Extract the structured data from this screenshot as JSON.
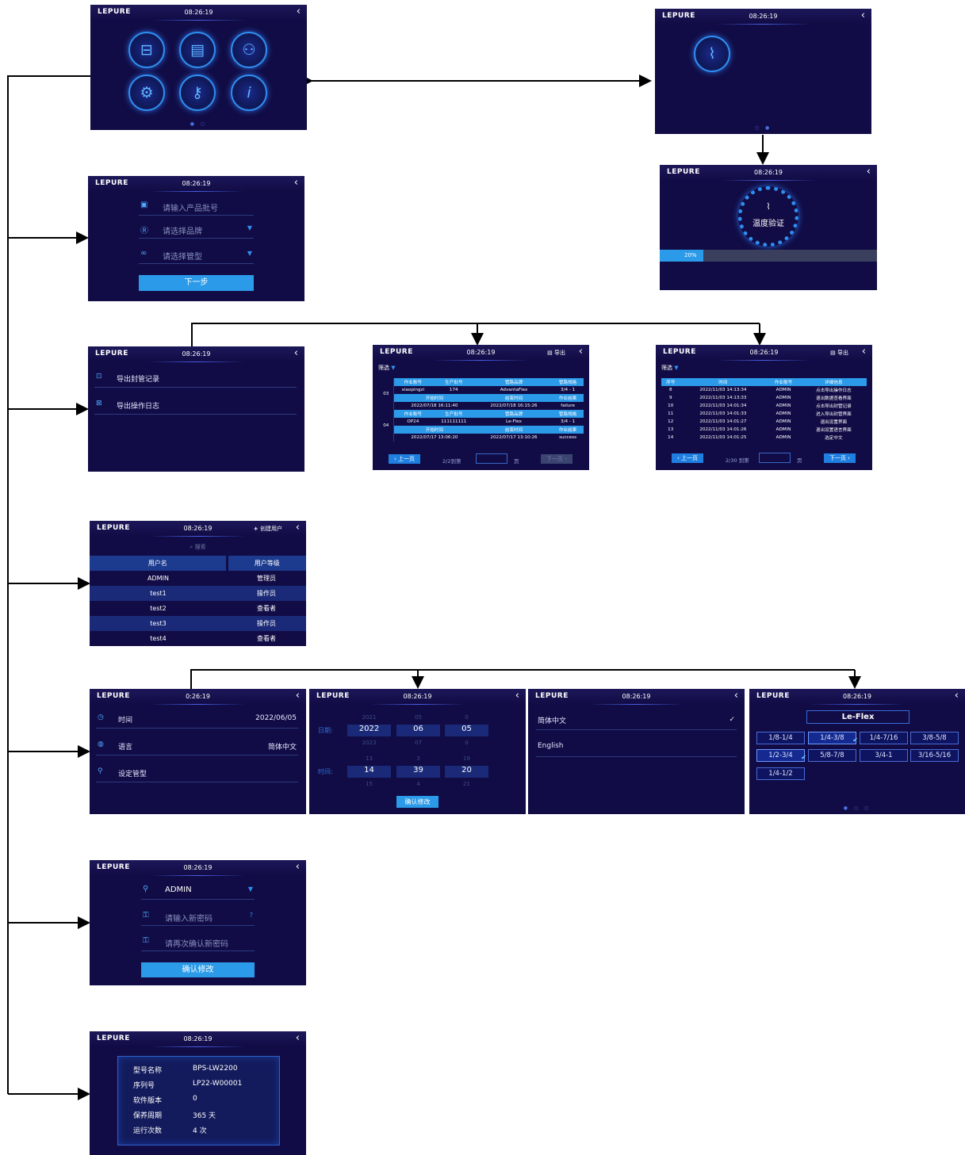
{
  "header": {
    "logo": "LEPURE",
    "time": "08:26:19",
    "time_alt": "0:26:19",
    "back": "‹"
  },
  "home": {
    "pager": "● ○",
    "pager2": "○ ●"
  },
  "temp": {
    "title": "温度验证",
    "progress_label": "20%",
    "progress_value": 0.2
  },
  "batch": {
    "product_placeholder": "请输入产品批号",
    "brand_placeholder": "请选择品牌",
    "tube_placeholder": "请选择管型",
    "next_label": "下一步"
  },
  "export": {
    "item1": "导出封管记录",
    "item2": "导出操作日志",
    "export_label": "导出",
    "filter_label": "筛选"
  },
  "record_table": {
    "head1": [
      "作业账号",
      "生产批号",
      "管路品牌",
      "管路规格"
    ],
    "head2": [
      "开始时间",
      "结束时间",
      "作业结果"
    ],
    "rows": [
      {
        "id": "03",
        "acct": "xiaopingzi",
        "lot": "174",
        "brand": "AdvantaFlex",
        "spec": "3/4 - 1",
        "start": "2022/07/18 16:11:40",
        "end": "2022/07/18 16:15:26",
        "result": "failure"
      },
      {
        "id": "04",
        "acct": "OP24",
        "lot": "111111111",
        "brand": "Le-Flex",
        "spec": "3/4 - 1",
        "start": "2022/07/17 13:06:20",
        "end": "2022/07/17 13:10:26",
        "result": "success"
      }
    ],
    "prev": "上一页",
    "next": "下一页",
    "page_info": "2/2到第",
    "page_unit": "页"
  },
  "log_table": {
    "head": [
      "序号",
      "时间",
      "作业账号",
      "详细信息"
    ],
    "rows": [
      [
        "8",
        "2022/11/03 14:13:34",
        "ADMIN",
        "点击导出操作日志"
      ],
      [
        "9",
        "2022/11/03 14:13:33",
        "ADMIN",
        "退出数据查看界面"
      ],
      [
        "10",
        "2022/11/03 14:01:34",
        "ADMIN",
        "点击导出封管记录"
      ],
      [
        "11",
        "2022/11/03 14:01:33",
        "ADMIN",
        "进入导出封管界面"
      ],
      [
        "12",
        "2022/11/03 14:01:27",
        "ADMIN",
        "退出设置界面"
      ],
      [
        "13",
        "2022/11/03 14:01:26",
        "ADMIN",
        "退出设置语言界面"
      ],
      [
        "14",
        "2022/11/03 14:01:25",
        "ADMIN",
        "选定中文"
      ]
    ],
    "prev": "上一页",
    "next": "下一页",
    "page_info": "2/30 到第",
    "page_unit": "页"
  },
  "users": {
    "create": "创建用户",
    "search": "搜索",
    "col_name": "用户名",
    "col_level": "用户等级",
    "rows": [
      [
        "ADMIN",
        "管理员"
      ],
      [
        "test1",
        "操作员"
      ],
      [
        "test2",
        "查看者"
      ],
      [
        "test3",
        "操作员"
      ],
      [
        "test4",
        "查看者"
      ]
    ]
  },
  "settings": {
    "time_label": "时间",
    "time_value": "2022/06/05",
    "lang_label": "语言",
    "lang_value": "简体中文",
    "tube_label": "设定管型"
  },
  "datetime": {
    "date_label": "日期:",
    "time_label": "时间:",
    "date_above": [
      "2021",
      "05",
      "0"
    ],
    "date_sel": [
      "2022",
      "06",
      "05"
    ],
    "date_below": [
      "2023",
      "07",
      "0"
    ],
    "time_above": [
      "13",
      "3",
      "19"
    ],
    "time_sel": [
      "14",
      "39",
      "20"
    ],
    "time_below": [
      "15",
      "4",
      "21"
    ],
    "confirm": "确认修改"
  },
  "language": {
    "opt1": "简体中文",
    "opt2": "English",
    "check": "✓"
  },
  "tube": {
    "brand": "Le-Flex",
    "sizes": [
      "1/8-1/4",
      "1/4-3/8",
      "1/4-7/16",
      "3/8-5/8",
      "1/2-3/4",
      "5/8-7/8",
      "3/4-1",
      "3/16-5/16",
      "1/4-1/2"
    ],
    "pager": "● ○ ○"
  },
  "password": {
    "user": "ADMIN",
    "new_placeholder": "请输入新密码",
    "confirm_placeholder": "请再次确认新密码",
    "confirm": "确认修改"
  },
  "info": {
    "rows": [
      [
        "型号名称",
        "BPS-LW2200"
      ],
      [
        "序列号",
        "LP22-W00001"
      ],
      [
        "软件版本",
        "0"
      ],
      [
        "保养周期",
        "365 天"
      ],
      [
        "运行次数",
        "4 次"
      ]
    ]
  },
  "colors": {
    "screen_bg": "#110c45",
    "accent": "#2b9ae8",
    "line": "#000000"
  }
}
